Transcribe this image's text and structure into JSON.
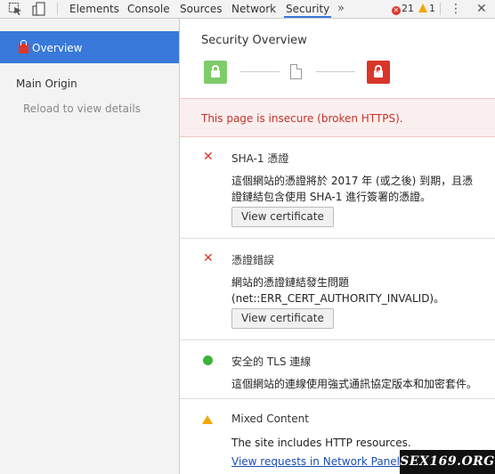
{
  "toolbar": {
    "tabs": [
      "Elements",
      "Console",
      "Sources",
      "Network",
      "Security"
    ],
    "more": "»",
    "error_count": "21",
    "warning_count": "1",
    "kebab": "⋮",
    "close": "✕"
  },
  "sidebar": {
    "overview_label": "Overview",
    "main_origin_label": "Main Origin",
    "reload_hint": "Reload to view details"
  },
  "main": {
    "title": "Security Overview",
    "insecure_message": "This page is insecure (broken HTTPS).",
    "sections": [
      {
        "title": "SHA-1 憑證",
        "body": "這個網站的憑證將於 2017 年 (或之後) 到期，且憑證鏈結包含使用 SHA-1 進行簽署的憑證。",
        "button": "View certificate"
      },
      {
        "title": "憑證錯誤",
        "body_line1": "網站的憑證鏈結發生問題",
        "body_line2": "(net::ERR_CERT_AUTHORITY_INVALID)。",
        "button": "View certificate"
      },
      {
        "title": "安全的 TLS 連線",
        "body": "這個網站的連線使用強式通訊協定版本和加密套件。"
      },
      {
        "title": "Mixed Content",
        "body": "The site includes HTTP resources.",
        "link": "View requests in Network Panel"
      }
    ]
  },
  "watermark": "SEX169.ORG",
  "colors": {
    "accent": "#3879d9",
    "error": "#d9362b",
    "secure": "#3bb33b",
    "warning": "#f4a700",
    "link": "#1a4db5"
  }
}
